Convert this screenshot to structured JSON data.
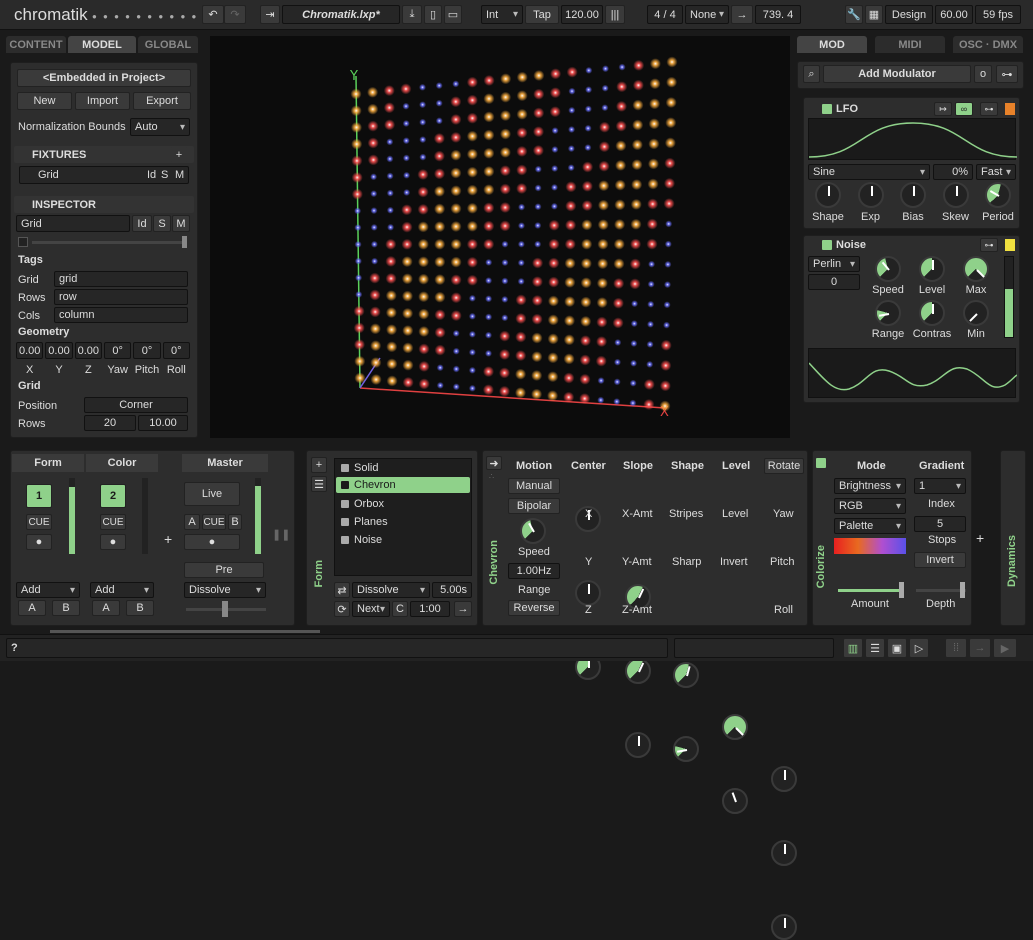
{
  "app": {
    "title": "chromatik",
    "project": "Chromatik.lxp*"
  },
  "toolbar": {
    "mode": "Int",
    "tap": "Tap",
    "bpm": "120.00",
    "beats": "4 / 4",
    "none": "None",
    "tempo": "739. 4",
    "design": "Design",
    "fps_target": "60.00",
    "fps": "59 fps"
  },
  "left_tabs": [
    "CONTENT",
    "MODEL",
    "GLOBAL"
  ],
  "model": {
    "embedded": "<Embedded in Project>",
    "new": "New",
    "import": "Import",
    "export": "Export",
    "norm_label": "Normalization Bounds",
    "norm_value": "Auto"
  },
  "fixtures": {
    "title": "FIXTURES",
    "item": "Grid",
    "i": "Id",
    "s": "S",
    "m": "M"
  },
  "inspector": {
    "title": "INSPECTOR",
    "name": "Grid",
    "i": "Id",
    "s": "S",
    "m": "M",
    "tags": "Tags",
    "tag_rows": [
      {
        "k": "Grid",
        "v": "grid"
      },
      {
        "k": "Rows",
        "v": "row"
      },
      {
        "k": "Cols",
        "v": "column"
      }
    ],
    "geometry": "Geometry",
    "geo_vals": [
      "0.00",
      "0.00",
      "0.00",
      "0°",
      "0°",
      "0°"
    ],
    "geo_labels": [
      "X",
      "Y",
      "Z",
      "Yaw",
      "Pitch",
      "Roll"
    ],
    "grid": "Grid",
    "pos_label": "Position",
    "pos_value": "Corner",
    "rows_label": "Rows",
    "rows_a": "20",
    "rows_b": "10.00"
  },
  "right_tabs": [
    "MOD",
    "MIDI",
    "OSC · DMX"
  ],
  "modulators": {
    "add": "Add Modulator",
    "o": "o",
    "lfo": {
      "title": "LFO",
      "wave": "Sine",
      "pct": "0%",
      "speed": "Fast",
      "knobs": [
        "Shape",
        "Exp",
        "Bias",
        "Skew",
        "Period"
      ]
    },
    "noise": {
      "title": "Noise",
      "algo": "Perlin",
      "val": "0",
      "knobs": [
        "Speed",
        "Level",
        "Max",
        "Range",
        "Contras",
        "Min"
      ]
    }
  },
  "mixer": {
    "form": "Form",
    "color": "Color",
    "master": "Master",
    "ch1": "1",
    "ch2": "2",
    "cue": "CUE",
    "live": "Live",
    "a": "A",
    "b": "B",
    "pre": "Pre",
    "add": "Add",
    "dissolve": "Dissolve"
  },
  "patterns": {
    "list": [
      "Solid",
      "Chevron",
      "Orbox",
      "Planes",
      "Noise"
    ],
    "selected": "Chevron",
    "form_label": "Form",
    "transition": "Dissolve",
    "time": "5.00s",
    "next": "Next",
    "c": "C",
    "ratio": "1:00"
  },
  "chevron": {
    "label": "Chevron",
    "cols": [
      "Motion",
      "Center",
      "Slope",
      "Shape",
      "Level",
      "Rotate"
    ],
    "motion": [
      "Manual",
      "Bipolar"
    ],
    "speed_label": "Speed",
    "speed_val": "1.00Hz",
    "range": "Range",
    "reverse": "Reverse",
    "knob_labels": [
      "X",
      "Y",
      "Z",
      "X-Amt",
      "Y-Amt",
      "Z-Amt",
      "Stripes",
      "Sharp",
      "Level",
      "Invert",
      "Yaw",
      "Pitch",
      "Roll"
    ]
  },
  "colorize": {
    "label": "Colorize",
    "mode": "Mode",
    "gradient": "Gradient",
    "brightness": "Brightness",
    "rgb": "RGB",
    "palette": "Palette",
    "index_val": "1",
    "index": "Index",
    "stops_val": "5",
    "stops": "Stops",
    "invert": "Invert",
    "amount": "Amount",
    "depth": "Depth"
  },
  "dynamics": {
    "label": "Dynamics"
  },
  "status": {
    "help": "?"
  }
}
